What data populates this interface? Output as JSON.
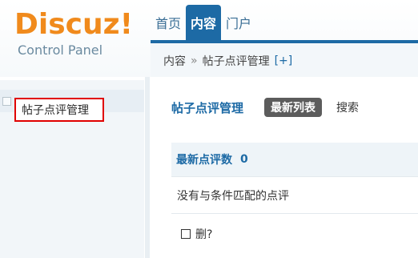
{
  "logo": {
    "main": "Discuz!",
    "sub": "Control Panel"
  },
  "nav": {
    "items": [
      {
        "label": "首页"
      },
      {
        "label": "内容",
        "active": true
      },
      {
        "label": "门户"
      }
    ],
    "accent_color": "#1d6aa5"
  },
  "breadcrumb": {
    "root": "内容",
    "separator": "»",
    "current": "帖子点评管理",
    "add_label": "[+]"
  },
  "sidebar": {
    "items": [
      {
        "label": "帖子点评管理",
        "selected": true
      }
    ]
  },
  "main": {
    "title": "帖子点评管理",
    "tabs": [
      {
        "label": "最新列表",
        "active": true
      },
      {
        "label": "搜索"
      }
    ],
    "stats": {
      "label": "最新点评数",
      "count": "0"
    },
    "empty_message": "没有与条件匹配的点评",
    "delete_label": "删?"
  }
}
